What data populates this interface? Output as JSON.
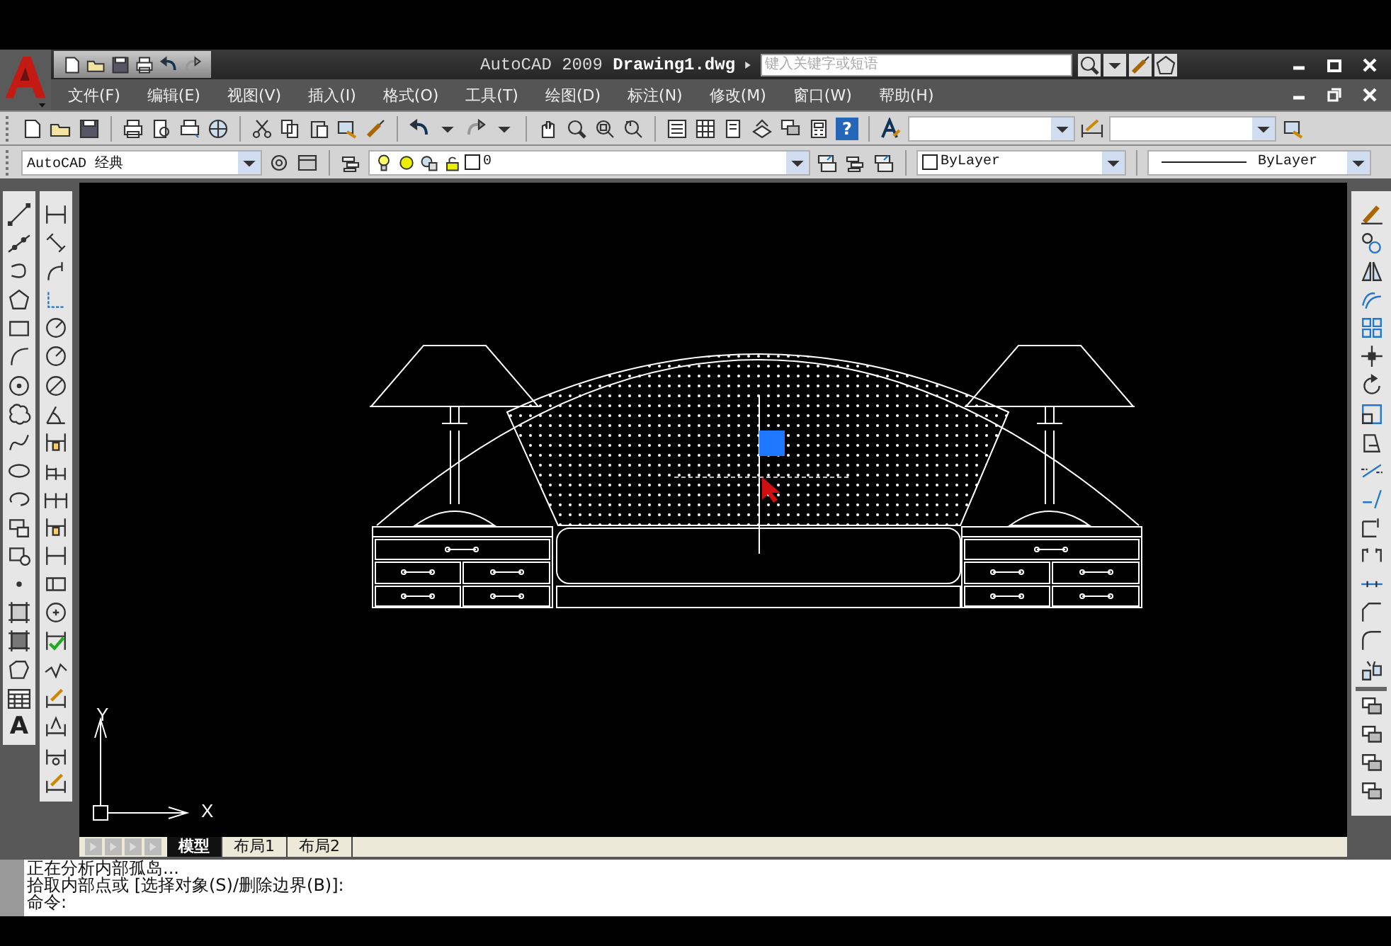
{
  "window": {
    "title": "AutoCAD 2009  **Drawing1.dwg**",
    "search": {
      "placeholder": "键入关键字或短语"
    }
  },
  "menu": [
    "文件(F)",
    "编辑(E)",
    "视图(V)",
    "插入(I)",
    "格式(O)",
    "工具(T)",
    "绘图(D)",
    "标注(N)",
    "修改(M)",
    "窗口(W)",
    "帮助(H)"
  ],
  "toolbar": {
    "help_glyph": "?",
    "workspace": "AutoCAD 经典",
    "layer": "0",
    "color_setting": "ByLayer",
    "linetype": "ByLayer"
  },
  "draw_toolbar": {
    "text_glyph": "A"
  },
  "canvas": {
    "ucs": {
      "x_label": "X",
      "y_label": "Y"
    }
  },
  "layout_tabs": [
    {
      "label": "模型",
      "selected": true
    },
    {
      "label": "布局1",
      "selected": false
    },
    {
      "label": "布局2",
      "selected": false
    }
  ],
  "command_lines": [
    "正在分析内部孤岛...",
    "拾取内部点或 [选择对象(S)/删除边界(B)]:",
    "命令:"
  ]
}
